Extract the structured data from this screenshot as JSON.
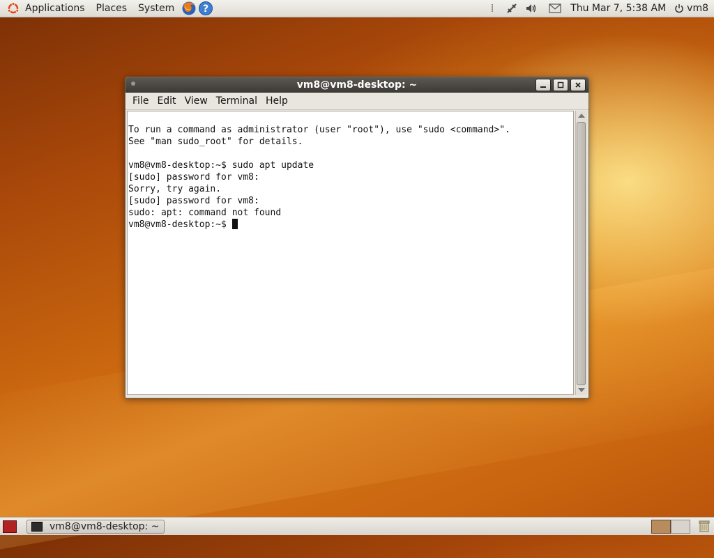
{
  "top_panel": {
    "menus": [
      "Applications",
      "Places",
      "System"
    ],
    "clock": "Thu Mar  7,  5:38 AM",
    "user": "vm8",
    "icons": [
      "ubuntu-logo-icon",
      "firefox-icon",
      "help-icon",
      "network-icon",
      "volume-icon",
      "mail-icon",
      "power-icon"
    ]
  },
  "window": {
    "title": "vm8@vm8-desktop: ~",
    "menus": [
      "File",
      "Edit",
      "View",
      "Terminal",
      "Help"
    ],
    "terminal_lines": [
      "To run a command as administrator (user \"root\"), use \"sudo <command>\".",
      "See \"man sudo_root\" for details.",
      "",
      "vm8@vm8-desktop:~$ sudo apt update",
      "[sudo] password for vm8:",
      "Sorry, try again.",
      "[sudo] password for vm8:",
      "sudo: apt: command not found"
    ],
    "prompt": "vm8@vm8-desktop:~$ "
  },
  "bottom_panel": {
    "task_label": "vm8@vm8-desktop: ~"
  },
  "colors": {
    "panel": "#dedbd4",
    "titlebar": "#3c3935",
    "terminal_bg": "#ffffff",
    "desktop_accent": "#d4781a"
  }
}
